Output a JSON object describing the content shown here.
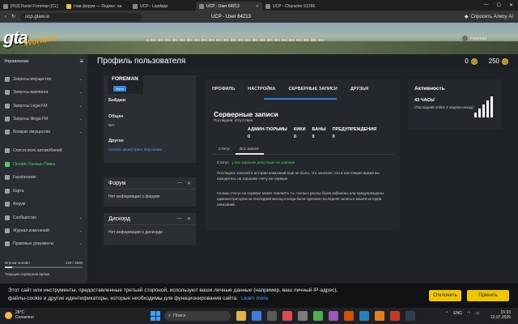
{
  "browser": {
    "tabs": [
      {
        "label": "[#53] Daniel Foreman [CL]",
        "active": false
      },
      {
        "label": "гтав форум — Яндекс: на",
        "active": false
      },
      {
        "label": "UCP - Lspdapp",
        "active": false
      },
      {
        "label": "UCP - User 64213",
        "active": true
      },
      {
        "label": "UCP - Character 61266",
        "active": false
      }
    ],
    "url": "ucp.gtaw.io",
    "title": "UCP - User 64213",
    "ask_ai": "Спросить Алису AI"
  },
  "header": {
    "logo_main": "gta",
    "logo_sub": "World.ru",
    "username": "Foreman",
    "page_title": "Профиль пользователя",
    "coins_1": "0",
    "coins_2": "250"
  },
  "sidebar": {
    "heading": "Управление",
    "items": [
      {
        "label": "Запросы имущество",
        "chevron": true
      },
      {
        "label": "Запросы маппинга",
        "chevron": true
      },
      {
        "label": "Запросы Legal FM",
        "chevron": true
      },
      {
        "label": "Запросы Illegal FM",
        "chevron": true
      },
      {
        "label": "Возврат имущества",
        "chevron": true
      },
      {
        "label": "Список всех автомобилей",
        "chevron": false
      },
      {
        "label": "Онлайн банные Пивка",
        "chevron": false
      },
      {
        "label": "Facebrowser",
        "chevron": false
      },
      {
        "label": "Карта",
        "chevron": false
      },
      {
        "label": "Форум",
        "chevron": false
      },
      {
        "label": "Сообщество",
        "chevron": true
      },
      {
        "label": "Журнал изменений",
        "chevron": true
      },
      {
        "label": "Правовые документы",
        "chevron": true
      }
    ],
    "online_label": "Игроки онлайн",
    "online_count": "135 / 1500",
    "online_fraction": 0.09,
    "queue_label": "Текущая серверная время"
  },
  "profile": {
    "nickname": "FOREMAN",
    "role_badge": "Игрок",
    "badges_label": "Бейджи",
    "general_label": "Общее",
    "general_value": "N/A",
    "other_label": "Другое",
    "other_link": "Скачать мониторинг персонажа"
  },
  "forum_card": {
    "title": "Форум",
    "body": "Нет информации о форуме"
  },
  "discord_card": {
    "title": "Дискорд",
    "body": "Нет информации о дискорде"
  },
  "center": {
    "tabs": [
      "ПРОФИЛЬ",
      "НАСТРОЙКА",
      "СЕРВЕРНЫЕ ЗАПИСИ",
      "ДРУЗЬЯ"
    ],
    "title": "Серверные записи",
    "subtitle": "Последний: отсутствие",
    "stats": [
      {
        "label": "АДМИН-ТЮРЬМЫ",
        "value": "0"
      },
      {
        "label": "КИКИ",
        "value": "0"
      },
      {
        "label": "БАНЫ",
        "value": "0"
      },
      {
        "label": "ПРЕДУПРЕЖДЕНИЯ",
        "value": "0"
      }
    ],
    "subtabs": [
      "Статус",
      "Все записи"
    ],
    "status_label": "Статус:",
    "status_value": "у вас хорошая репутация на сервере",
    "para1": "Последних записей в истории наказаний еще не было, что означает, что в настоящее время вы находитесь на хорошем счету на сервере.",
    "para2": "На ваш статус на сервере может повлиять то, сколько раз вы были забанены или предупреждены администратором за последний месяц и когда была сделана последняя запись в вашей истории наказаний."
  },
  "activity": {
    "title": "Активность",
    "hours": "43 ЧАСЫ",
    "note": "(Последний online 2 недели назад)",
    "signal_level": 4,
    "signal_max": 5
  },
  "cookie": {
    "text": "Этот сайт или инструменты, предоставленные третьей стороной, используют ваши личные данные (например, ваш личный IP-адрес), файлы-cookie и другие идентификаторы, которые необходимы для функционирования сайта.",
    "learn_more": "Learn more",
    "decline": "Отклонить",
    "accept": "Принять"
  },
  "taskbar": {
    "temp": "26°C",
    "weather": "Солнечно",
    "search": "Поиск",
    "lang": "ENG",
    "time": "15:33",
    "date": "13.07.2026"
  },
  "colors": {
    "accent": "#2f86d8",
    "online_green": "#4bd163",
    "cookie_button": "#f0c600"
  }
}
